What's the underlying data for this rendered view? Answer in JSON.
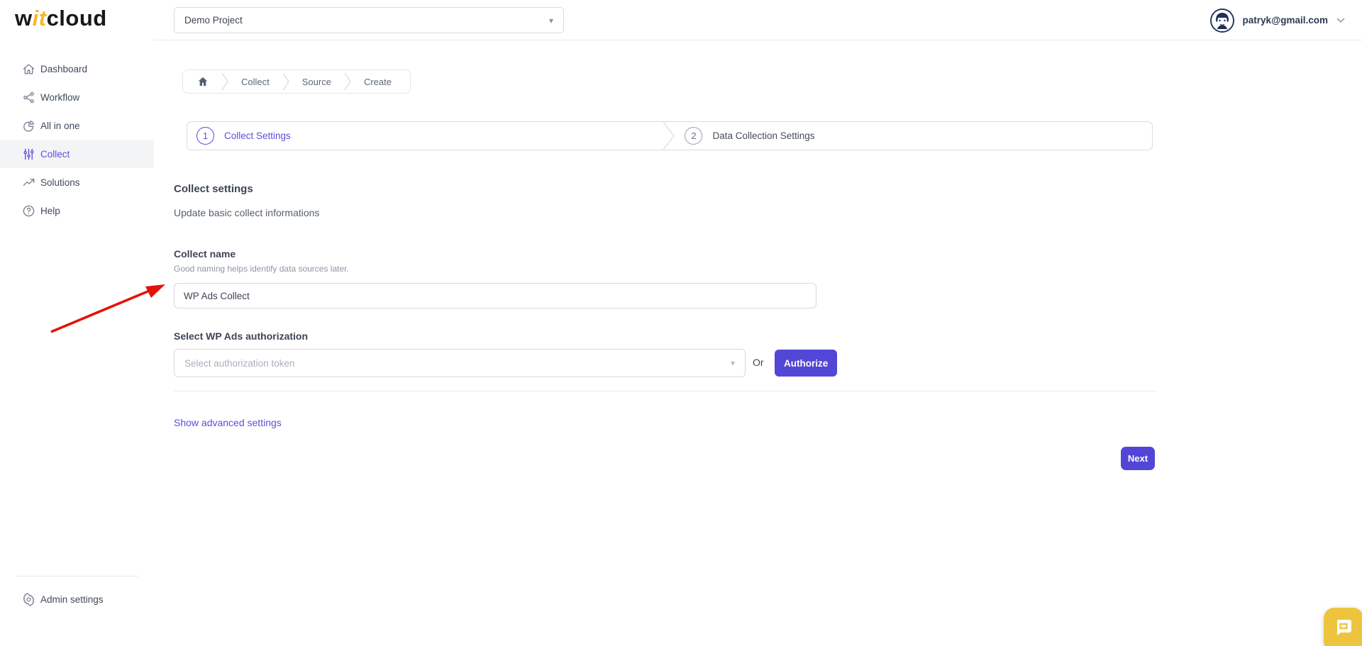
{
  "logo": {
    "prefix": "w",
    "accent": "it",
    "suffix": "cloud",
    "accent_color": "#f6b92c"
  },
  "header": {
    "project_select": {
      "value": "Demo Project"
    },
    "user_email": "patryk@gmail.com"
  },
  "sidebar": {
    "items": [
      {
        "label": "Dashboard",
        "icon": "home-icon",
        "active": false
      },
      {
        "label": "Workflow",
        "icon": "workflow-icon",
        "active": false
      },
      {
        "label": "All in one",
        "icon": "pie-chart-icon",
        "active": false
      },
      {
        "label": "Collect",
        "icon": "sliders-icon",
        "active": true
      },
      {
        "label": "Solutions",
        "icon": "trending-up-icon",
        "active": false
      },
      {
        "label": "Help",
        "icon": "help-circle-icon",
        "active": false
      }
    ],
    "footer_item": {
      "label": "Admin settings",
      "icon": "gear-icon"
    }
  },
  "breadcrumb": {
    "home_icon": "home-icon",
    "items": [
      "Collect",
      "Source",
      "Create"
    ]
  },
  "stepper": {
    "steps": [
      {
        "number": "1",
        "label": "Collect Settings",
        "active": true
      },
      {
        "number": "2",
        "label": "Data Collection Settings",
        "active": false
      }
    ]
  },
  "form": {
    "section_title": "Collect settings",
    "section_subtitle": "Update basic collect informations",
    "collect_name": {
      "label": "Collect name",
      "hint": "Good naming helps identify data sources later.",
      "value": "WP Ads Collect"
    },
    "authorization": {
      "label": "Select WP Ads authorization",
      "placeholder": "Select authorization token",
      "or_label": "Or",
      "authorize_button": "Authorize"
    },
    "advanced_link": "Show advanced settings",
    "next_button": "Next"
  },
  "annotations": {
    "red_arrow_color": "#e41309"
  },
  "chat_widget": {
    "background": "#eec43e",
    "icon": "chat-bubble-icon"
  },
  "colors": {
    "accent": "#5a4fdf",
    "button": "#5246d6"
  }
}
